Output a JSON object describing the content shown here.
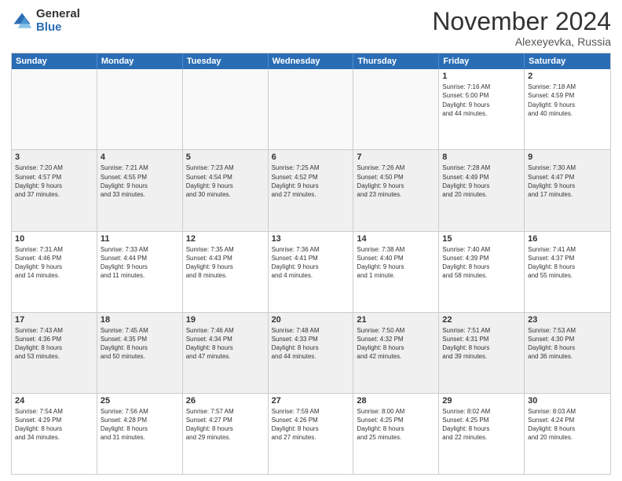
{
  "logo": {
    "general": "General",
    "blue": "Blue"
  },
  "title": "November 2024",
  "location": "Alexeyevka, Russia",
  "header": {
    "days": [
      "Sunday",
      "Monday",
      "Tuesday",
      "Wednesday",
      "Thursday",
      "Friday",
      "Saturday"
    ]
  },
  "weeks": [
    [
      {
        "day": "",
        "info": "",
        "empty": true
      },
      {
        "day": "",
        "info": "",
        "empty": true
      },
      {
        "day": "",
        "info": "",
        "empty": true
      },
      {
        "day": "",
        "info": "",
        "empty": true
      },
      {
        "day": "",
        "info": "",
        "empty": true
      },
      {
        "day": "1",
        "info": "Sunrise: 7:16 AM\nSunset: 5:00 PM\nDaylight: 9 hours\nand 44 minutes.",
        "empty": false
      },
      {
        "day": "2",
        "info": "Sunrise: 7:18 AM\nSunset: 4:59 PM\nDaylight: 9 hours\nand 40 minutes.",
        "empty": false
      }
    ],
    [
      {
        "day": "3",
        "info": "Sunrise: 7:20 AM\nSunset: 4:57 PM\nDaylight: 9 hours\nand 37 minutes.",
        "empty": false
      },
      {
        "day": "4",
        "info": "Sunrise: 7:21 AM\nSunset: 4:55 PM\nDaylight: 9 hours\nand 33 minutes.",
        "empty": false
      },
      {
        "day": "5",
        "info": "Sunrise: 7:23 AM\nSunset: 4:54 PM\nDaylight: 9 hours\nand 30 minutes.",
        "empty": false
      },
      {
        "day": "6",
        "info": "Sunrise: 7:25 AM\nSunset: 4:52 PM\nDaylight: 9 hours\nand 27 minutes.",
        "empty": false
      },
      {
        "day": "7",
        "info": "Sunrise: 7:26 AM\nSunset: 4:50 PM\nDaylight: 9 hours\nand 23 minutes.",
        "empty": false
      },
      {
        "day": "8",
        "info": "Sunrise: 7:28 AM\nSunset: 4:49 PM\nDaylight: 9 hours\nand 20 minutes.",
        "empty": false
      },
      {
        "day": "9",
        "info": "Sunrise: 7:30 AM\nSunset: 4:47 PM\nDaylight: 9 hours\nand 17 minutes.",
        "empty": false
      }
    ],
    [
      {
        "day": "10",
        "info": "Sunrise: 7:31 AM\nSunset: 4:46 PM\nDaylight: 9 hours\nand 14 minutes.",
        "empty": false
      },
      {
        "day": "11",
        "info": "Sunrise: 7:33 AM\nSunset: 4:44 PM\nDaylight: 9 hours\nand 11 minutes.",
        "empty": false
      },
      {
        "day": "12",
        "info": "Sunrise: 7:35 AM\nSunset: 4:43 PM\nDaylight: 9 hours\nand 8 minutes.",
        "empty": false
      },
      {
        "day": "13",
        "info": "Sunrise: 7:36 AM\nSunset: 4:41 PM\nDaylight: 9 hours\nand 4 minutes.",
        "empty": false
      },
      {
        "day": "14",
        "info": "Sunrise: 7:38 AM\nSunset: 4:40 PM\nDaylight: 9 hours\nand 1 minute.",
        "empty": false
      },
      {
        "day": "15",
        "info": "Sunrise: 7:40 AM\nSunset: 4:39 PM\nDaylight: 8 hours\nand 58 minutes.",
        "empty": false
      },
      {
        "day": "16",
        "info": "Sunrise: 7:41 AM\nSunset: 4:37 PM\nDaylight: 8 hours\nand 55 minutes.",
        "empty": false
      }
    ],
    [
      {
        "day": "17",
        "info": "Sunrise: 7:43 AM\nSunset: 4:36 PM\nDaylight: 8 hours\nand 53 minutes.",
        "empty": false
      },
      {
        "day": "18",
        "info": "Sunrise: 7:45 AM\nSunset: 4:35 PM\nDaylight: 8 hours\nand 50 minutes.",
        "empty": false
      },
      {
        "day": "19",
        "info": "Sunrise: 7:46 AM\nSunset: 4:34 PM\nDaylight: 8 hours\nand 47 minutes.",
        "empty": false
      },
      {
        "day": "20",
        "info": "Sunrise: 7:48 AM\nSunset: 4:33 PM\nDaylight: 8 hours\nand 44 minutes.",
        "empty": false
      },
      {
        "day": "21",
        "info": "Sunrise: 7:50 AM\nSunset: 4:32 PM\nDaylight: 8 hours\nand 42 minutes.",
        "empty": false
      },
      {
        "day": "22",
        "info": "Sunrise: 7:51 AM\nSunset: 4:31 PM\nDaylight: 8 hours\nand 39 minutes.",
        "empty": false
      },
      {
        "day": "23",
        "info": "Sunrise: 7:53 AM\nSunset: 4:30 PM\nDaylight: 8 hours\nand 36 minutes.",
        "empty": false
      }
    ],
    [
      {
        "day": "24",
        "info": "Sunrise: 7:54 AM\nSunset: 4:29 PM\nDaylight: 8 hours\nand 34 minutes.",
        "empty": false
      },
      {
        "day": "25",
        "info": "Sunrise: 7:56 AM\nSunset: 4:28 PM\nDaylight: 8 hours\nand 31 minutes.",
        "empty": false
      },
      {
        "day": "26",
        "info": "Sunrise: 7:57 AM\nSunset: 4:27 PM\nDaylight: 8 hours\nand 29 minutes.",
        "empty": false
      },
      {
        "day": "27",
        "info": "Sunrise: 7:59 AM\nSunset: 4:26 PM\nDaylight: 8 hours\nand 27 minutes.",
        "empty": false
      },
      {
        "day": "28",
        "info": "Sunrise: 8:00 AM\nSunset: 4:25 PM\nDaylight: 8 hours\nand 25 minutes.",
        "empty": false
      },
      {
        "day": "29",
        "info": "Sunrise: 8:02 AM\nSunset: 4:25 PM\nDaylight: 8 hours\nand 22 minutes.",
        "empty": false
      },
      {
        "day": "30",
        "info": "Sunrise: 8:03 AM\nSunset: 4:24 PM\nDaylight: 8 hours\nand 20 minutes.",
        "empty": false
      }
    ]
  ]
}
